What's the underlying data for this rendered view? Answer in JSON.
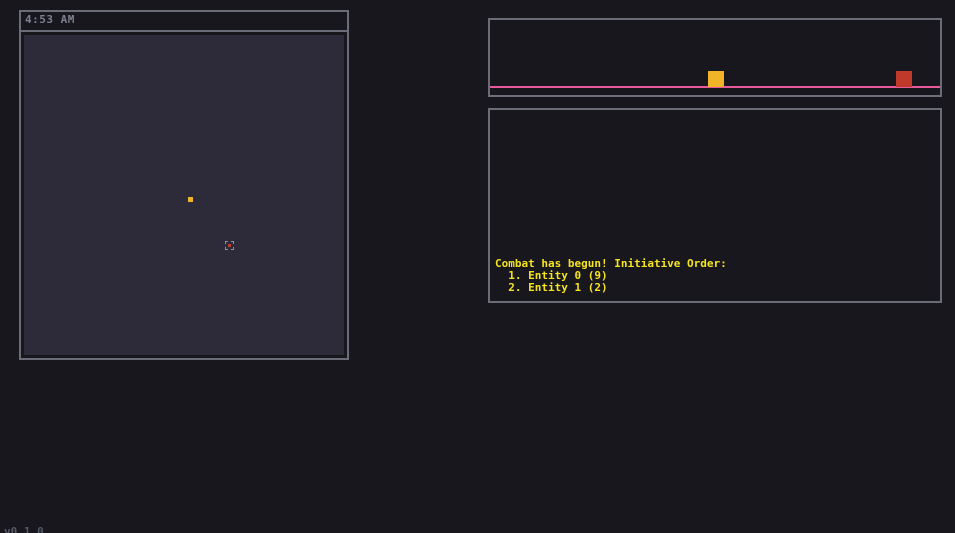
{
  "hud": {
    "clock": "4:53 AM",
    "version": "v0.1.0"
  },
  "map": {
    "entities": [
      {
        "name": "Entity 0",
        "icon": "player-marker-icon",
        "color": "#f0b429"
      },
      {
        "name": "Entity 1",
        "icon": "enemy-marker-icon",
        "color": "#c0392b"
      }
    ]
  },
  "initiative_tracker": {
    "track_color": "#e85a9a",
    "tokens": [
      {
        "entity": "Entity 0",
        "color": "#f0b429"
      },
      {
        "entity": "Entity 1",
        "color": "#c0392b"
      }
    ]
  },
  "combat_log": {
    "text_color": "#f5e41c",
    "lines": [
      "Combat has begun! Initiative Order:",
      "  1. Entity 0 (9)",
      "  2. Entity 1 (2)"
    ]
  }
}
